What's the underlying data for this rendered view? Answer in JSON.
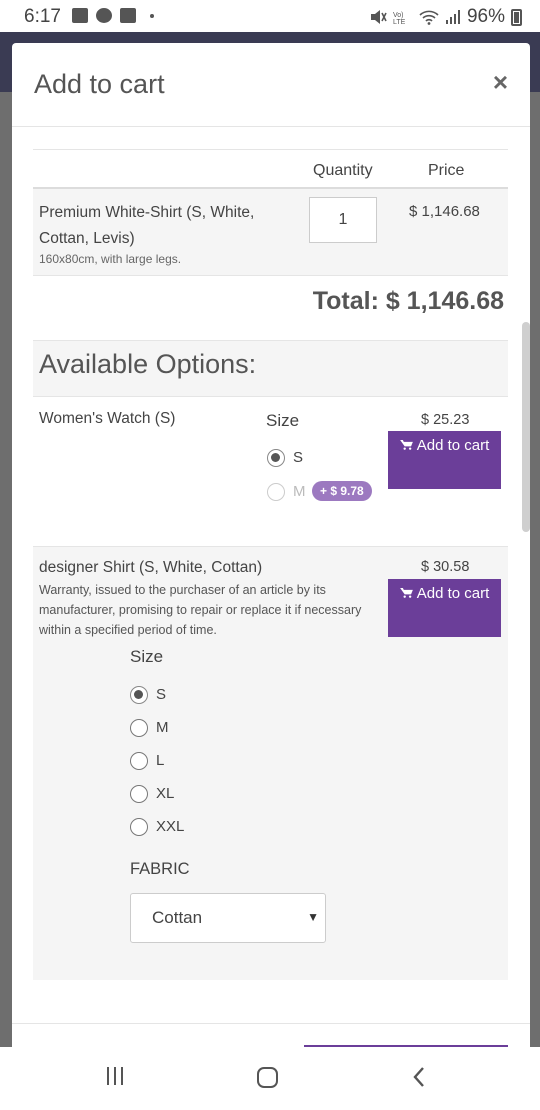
{
  "status_bar": {
    "time": "6:17",
    "battery": "96%",
    "left_icons": [
      "image-icon",
      "whatsapp-icon",
      "folder-icon",
      "dot-icon"
    ],
    "right_icons": [
      "mute-icon",
      "volte-icon",
      "wifi-icon",
      "signal-icon",
      "battery-icon"
    ]
  },
  "modal": {
    "title": "Add to cart",
    "close_label": "×",
    "table": {
      "col_quantity": "Quantity",
      "col_price": "Price",
      "item": {
        "name": "Premium White-Shirt (S, White, Cottan, Levis)",
        "description": "160x80cm, with large legs.",
        "quantity": "1",
        "price": "$ 1,146.68"
      },
      "total": "Total: $ 1,146.68"
    },
    "options_title": "Available Options:",
    "options": [
      {
        "name": "Women's Watch (S)",
        "price": "$ 25.23",
        "button_label": "Add to cart",
        "size_label": "Size",
        "sizes": [
          {
            "label": "S",
            "checked": true,
            "disabled": false
          },
          {
            "label": "M",
            "checked": false,
            "disabled": true,
            "extra": "+ $ 9.78"
          }
        ]
      },
      {
        "name": "designer Shirt (S, White, Cottan)",
        "description": "Warranty, issued to the purchaser of an article by its manufacturer, promising to repair or replace it if necessary within a specified period of time.",
        "price": "$ 30.58",
        "button_label": "Add to cart",
        "size_label": "Size",
        "sizes": [
          {
            "label": "S",
            "checked": true
          },
          {
            "label": "M",
            "checked": false
          },
          {
            "label": "L",
            "checked": false
          },
          {
            "label": "XL",
            "checked": false
          },
          {
            "label": "XXL",
            "checked": false
          }
        ],
        "fabric_label": "FABRIC",
        "fabric_value": "Cottan"
      }
    ]
  },
  "colors": {
    "accent": "#6b3e99",
    "pill": "#9c79c0",
    "backdrop": "#6e6e6e",
    "header_dark": "#3a3b53"
  }
}
